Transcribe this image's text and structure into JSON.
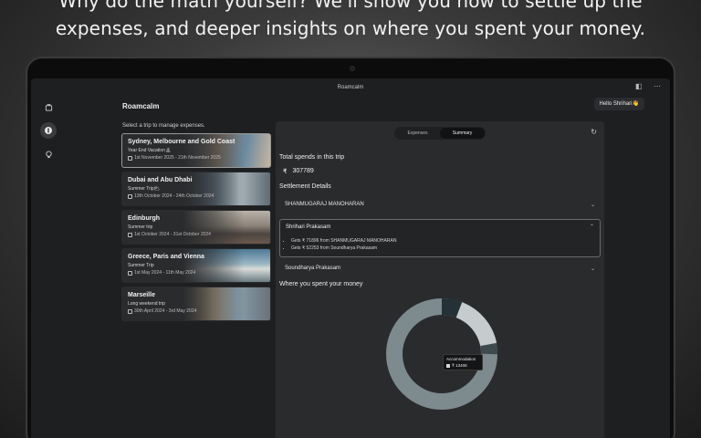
{
  "headline": "Why do the math yourself? We'll show you how to settle up the\nexpenses, and deeper insights on where you spent your money.",
  "window": {
    "title": "Roamcalm"
  },
  "app": {
    "name": "Roamcalm",
    "greeting": "Hello Shrihari👋"
  },
  "sidebar": {
    "items": [
      {
        "icon": "briefcase-icon",
        "active": false
      },
      {
        "icon": "wallet-icon",
        "active": true
      },
      {
        "icon": "lightbulb-icon",
        "active": false
      }
    ]
  },
  "trips": {
    "prompt": "Select a trip to manage expenses.",
    "items": [
      {
        "name": "Sydney, Melbourne and Gold Coast",
        "type": "Year End Vacation🏝",
        "dates": "1st November 2025 - 21th November 2025",
        "selected": true
      },
      {
        "name": "Dubai and Abu Dhabi",
        "type": "Summer Trip🌥",
        "dates": "13th October 2024 - 24th October 2024",
        "selected": false
      },
      {
        "name": "Edinburgh",
        "type": "Summer trip",
        "dates": "1st October 2024 - 31st October 2024",
        "selected": false
      },
      {
        "name": "Greece, Paris and Vienna",
        "type": "Summer Trip",
        "dates": "1st May 2024 - 11th May 2024",
        "selected": false
      },
      {
        "name": "Marseille",
        "type": "Long weekend trip",
        "dates": "30th April 2024 - 3rd May 2024",
        "selected": false
      }
    ]
  },
  "panel": {
    "tabs": [
      {
        "label": "Expenses",
        "active": false
      },
      {
        "label": "Summary",
        "active": true
      }
    ],
    "total_label": "Total spends in this trip",
    "currency": "₹",
    "total_value": "307789",
    "settlement_label": "Settlement Details",
    "people": [
      {
        "name": "SHANMUGARAJ MANOHARAN",
        "expanded": false
      },
      {
        "name": "Shrihari Prakasam",
        "expanded": true,
        "lines": [
          "Gets ₹ 71896 from SHANMUGARAJ MANOHARAN",
          "Gets ₹ 52253 from Soundharya Prakasam"
        ]
      },
      {
        "name": "Soundharya Prakasam",
        "expanded": false
      }
    ],
    "spent_label": "Where you spent your money",
    "tooltip": {
      "category": "Accommodation",
      "value": "₹ 13408"
    }
  },
  "colors": {
    "background": "#1e1f21",
    "panel": "#2a2b2d",
    "donut_main": "#7d8a8e",
    "donut_light": "#c6ccce",
    "donut_dark": "#243238"
  }
}
